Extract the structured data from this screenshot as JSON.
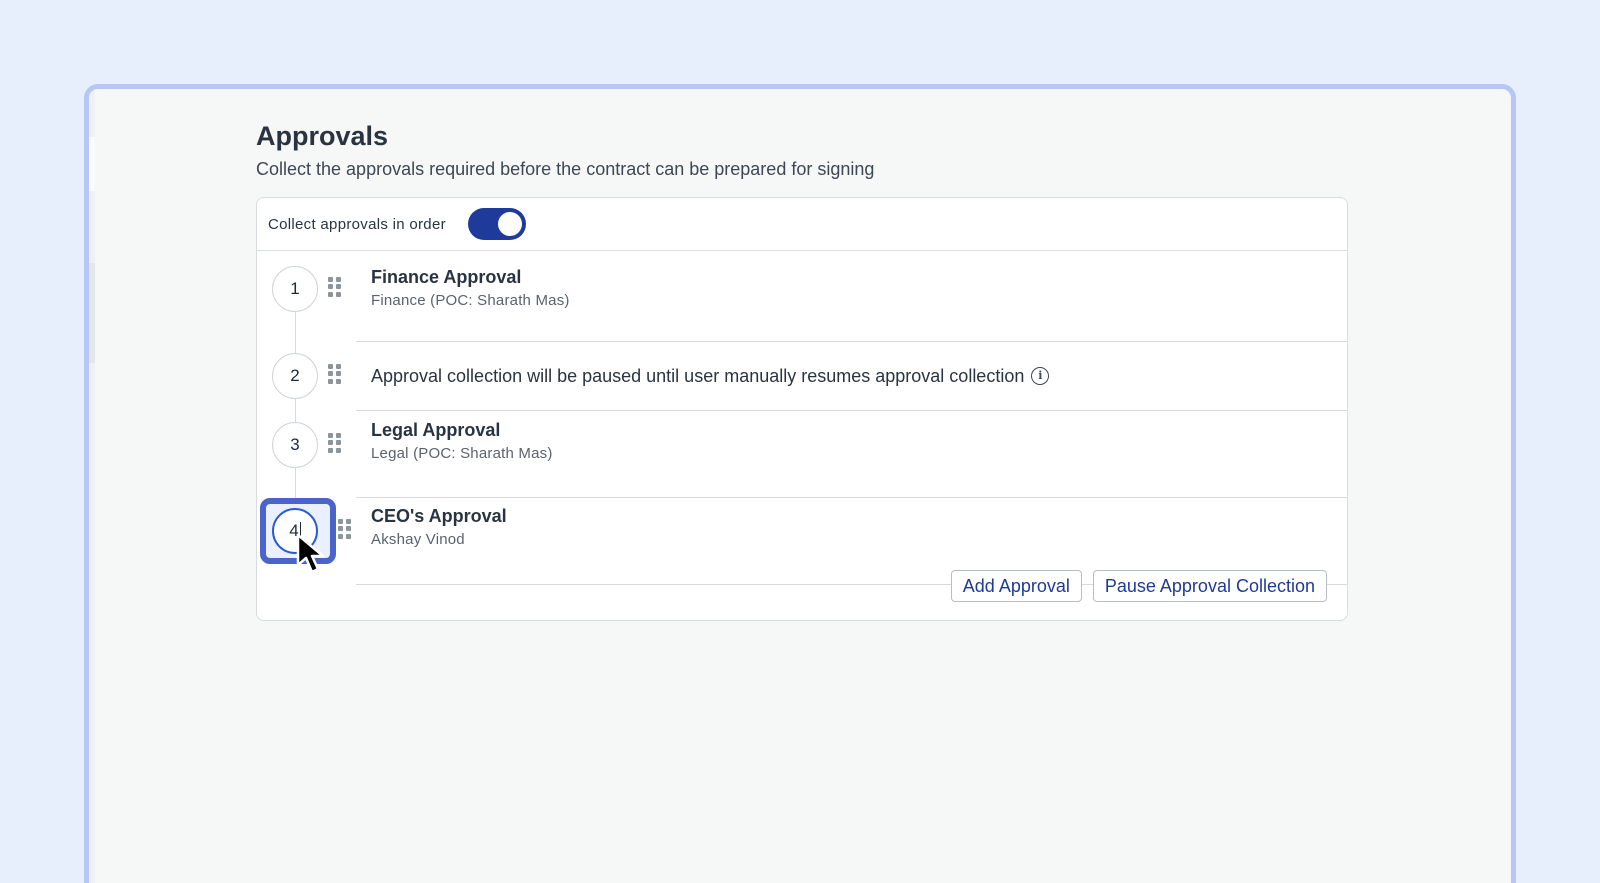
{
  "page": {
    "title": "Approvals",
    "subtitle": "Collect the approvals required before the contract can be prepared for signing"
  },
  "settings": {
    "order_label": "Collect approvals in order",
    "order_toggle_on": true
  },
  "steps": [
    {
      "number": "1",
      "type": "approval",
      "title": "Finance Approval",
      "subtitle": "Finance (POC: Sharath Mas)"
    },
    {
      "number": "2",
      "type": "pause",
      "text": "Approval collection will be paused until user manually resumes approval collection",
      "icon": "info-icon"
    },
    {
      "number": "3",
      "type": "approval",
      "title": "Legal Approval",
      "subtitle": "Legal (POC: Sharath Mas)"
    },
    {
      "number": "4",
      "type": "approval",
      "title": "CEO's Approval",
      "subtitle": "Akshay Vinod",
      "editing": true
    }
  ],
  "actions": {
    "add_label": "Add Approval",
    "pause_label": "Pause Approval Collection"
  },
  "colors": {
    "accent": "#1e3a9b",
    "focus": "#4a64c9",
    "background": "#e8effc"
  }
}
